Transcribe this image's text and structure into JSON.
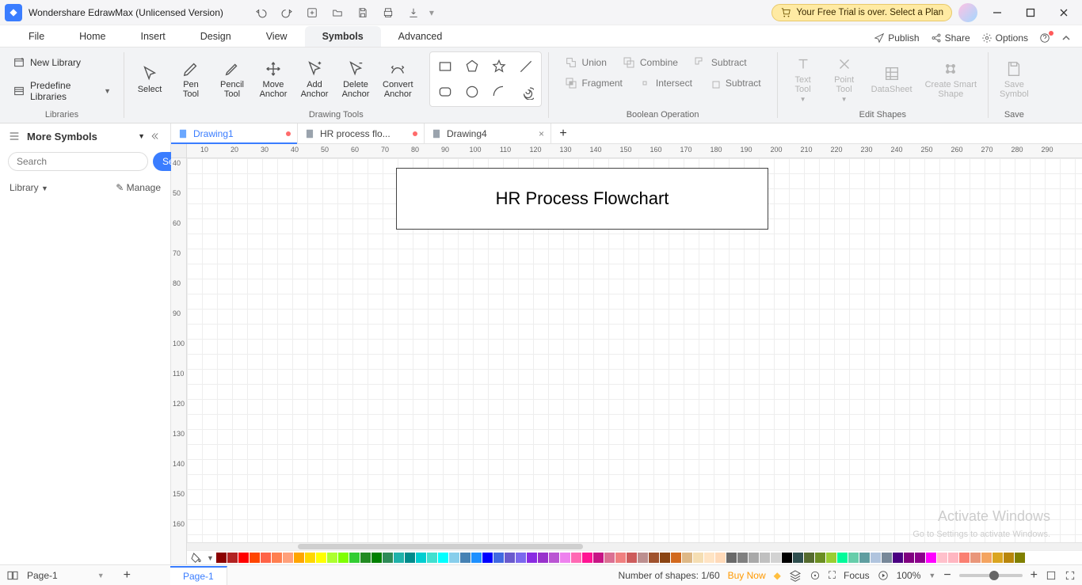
{
  "title_bar": {
    "app_name": "Wondershare EdrawMax (Unlicensed Version)",
    "trial_text": "Your Free Trial is over. Select a Plan"
  },
  "menus": {
    "file": "File",
    "home": "Home",
    "insert": "Insert",
    "design": "Design",
    "view": "View",
    "symbols": "Symbols",
    "advanced": "Advanced",
    "publish": "Publish",
    "share": "Share",
    "options": "Options"
  },
  "ribbon": {
    "group_libraries": "Libraries",
    "new_library": "New Library",
    "predefine_libraries": "Predefine Libraries",
    "group_drawing": "Drawing Tools",
    "select": "Select",
    "pen": "Pen\nTool",
    "pencil": "Pencil\nTool",
    "move_anchor": "Move\nAnchor",
    "add_anchor": "Add\nAnchor",
    "delete_anchor": "Delete\nAnchor",
    "convert_anchor": "Convert\nAnchor",
    "group_boolean": "Boolean Operation",
    "union": "Union",
    "combine": "Combine",
    "subtract": "Subtract",
    "fragment": "Fragment",
    "intersect": "Intersect",
    "subtract2": "Subtract",
    "group_edit": "Edit Shapes",
    "text_tool": "Text\nTool",
    "point_tool": "Point\nTool",
    "datasheet": "DataSheet",
    "smart_shape": "Create Smart\nShape",
    "group_save": "Save",
    "save_symbol": "Save\nSymbol"
  },
  "sidebar": {
    "more_symbols": "More Symbols",
    "search_placeholder": "Search",
    "search_btn": "Search",
    "library_label": "Library",
    "manage": "Manage"
  },
  "doc_tabs": {
    "t1": "Drawing1",
    "t2": "HR process flo...",
    "t3": "Drawing4"
  },
  "canvas": {
    "title_box": "HR Process Flowchart",
    "watermark1": "Activate Windows",
    "watermark2": "Go to Settings to activate Windows."
  },
  "ruler_top": [
    "10",
    "20",
    "30",
    "40",
    "50",
    "60",
    "70",
    "80",
    "90",
    "100",
    "110",
    "120",
    "130",
    "140",
    "150",
    "160",
    "170",
    "180",
    "190",
    "200",
    "210",
    "220",
    "230",
    "240",
    "250",
    "260",
    "270",
    "280",
    "290"
  ],
  "ruler_left": [
    "40",
    "50",
    "60",
    "70",
    "80",
    "90",
    "100",
    "110",
    "120",
    "130",
    "140",
    "150",
    "160"
  ],
  "status": {
    "page_tab": "Page-1",
    "page_sel": "Page-1",
    "shapes": "Number of shapes: 1/60",
    "buy": "Buy Now",
    "focus": "Focus",
    "zoom": "100%"
  },
  "colors": [
    "#8B0000",
    "#B22222",
    "#FF0000",
    "#FF4500",
    "#FF6347",
    "#FF7F50",
    "#FFA07A",
    "#FFA500",
    "#FFD700",
    "#FFFF00",
    "#ADFF2F",
    "#7FFF00",
    "#32CD32",
    "#228B22",
    "#008000",
    "#2E8B57",
    "#20B2AA",
    "#008B8B",
    "#00CED1",
    "#40E0D0",
    "#00FFFF",
    "#87CEEB",
    "#4682B4",
    "#1E90FF",
    "#0000FF",
    "#4169E1",
    "#6A5ACD",
    "#7B68EE",
    "#8A2BE2",
    "#9932CC",
    "#BA55D3",
    "#EE82EE",
    "#FF69B4",
    "#FF1493",
    "#C71585",
    "#DB7093",
    "#F08080",
    "#CD5C5C",
    "#BC8F8F",
    "#A0522D",
    "#8B4513",
    "#D2691E",
    "#DEB887",
    "#F5DEB3",
    "#FFE4C4",
    "#FFDAB9",
    "#696969",
    "#808080",
    "#A9A9A9",
    "#C0C0C0",
    "#D3D3D3",
    "#000000",
    "#2F4F4F",
    "#556B2F",
    "#6B8E23",
    "#9ACD32",
    "#00FA9A",
    "#66CDAA",
    "#5F9EA0",
    "#B0C4DE",
    "#778899",
    "#4B0082",
    "#800080",
    "#8B008B",
    "#FF00FF",
    "#FFC0CB",
    "#FFB6C1",
    "#FA8072",
    "#E9967A",
    "#F4A460",
    "#DAA520",
    "#B8860B",
    "#808000"
  ]
}
